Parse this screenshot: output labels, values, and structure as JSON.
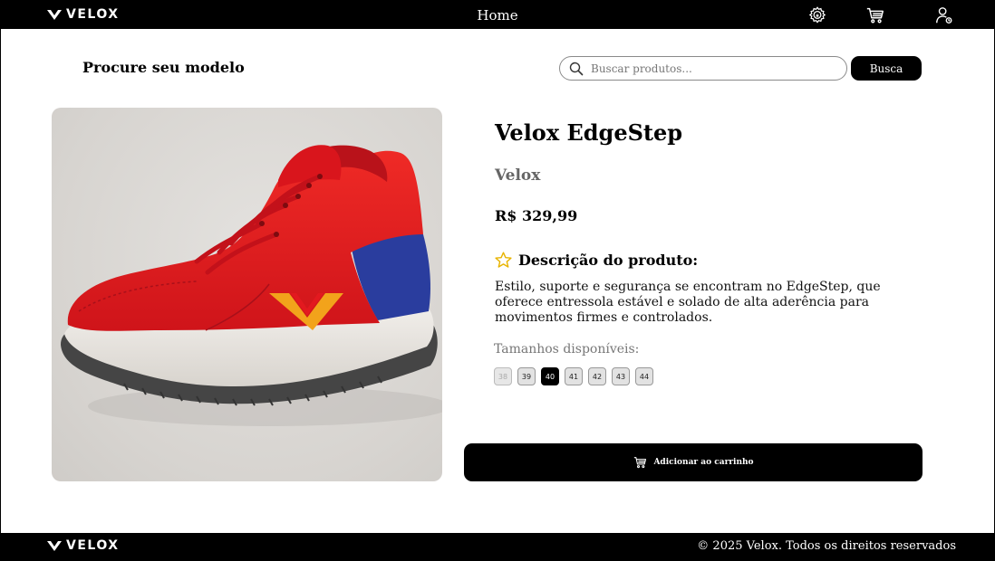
{
  "header": {
    "brand": "VELOX",
    "nav_home": "Home",
    "icons": [
      "settings-icon",
      "cart-icon",
      "user-account-icon"
    ]
  },
  "search": {
    "section_title": "Procure seu modelo",
    "placeholder": "Buscar produtos...",
    "value": "",
    "button_label": "Busca"
  },
  "product": {
    "name": "Velox EdgeStep",
    "brand": "Velox",
    "price": "R$ 329,99",
    "description_title": "Descrição do produto:",
    "description": "Estilo, suporte e segurança se encontram no EdgeStep, que oferece entressola estável e solado de alta aderência para movimentos firmes e controlados.",
    "sizes_label": "Tamanhos disponíveis:",
    "sizes": [
      {
        "label": "38",
        "state": "disabled"
      },
      {
        "label": "39",
        "state": "available"
      },
      {
        "label": "40",
        "state": "selected"
      },
      {
        "label": "41",
        "state": "available"
      },
      {
        "label": "42",
        "state": "available"
      },
      {
        "label": "43",
        "state": "available"
      },
      {
        "label": "44",
        "state": "available"
      }
    ],
    "add_to_cart_label": "Adicionar ao carrinho",
    "colors": {
      "upper": "#e3191f",
      "heel_panel": "#2a3d9e",
      "logo": "#f2a31b",
      "midsole": "#e9e6e1",
      "outsole": "#454545"
    }
  },
  "footer": {
    "brand": "VELOX",
    "copyright": "© 2025 Velox. Todos os direitos reservados"
  },
  "colors": {
    "primary": "#000000",
    "background": "#ffffff",
    "star": "#e8b400"
  }
}
